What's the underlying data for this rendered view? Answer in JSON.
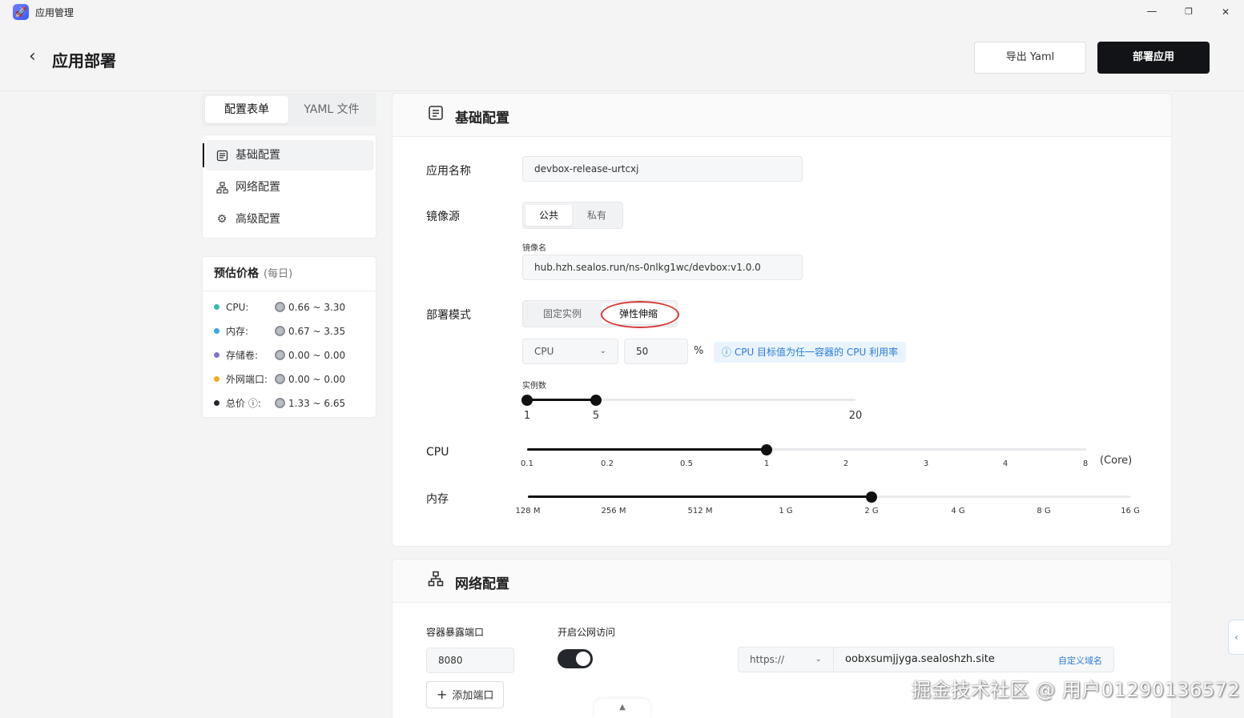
{
  "window": {
    "title": "应用管理",
    "controls": {
      "minimize": "—",
      "maximize": "❐",
      "close": "✕"
    }
  },
  "header": {
    "title": "应用部署",
    "export_label": "导出 Yaml",
    "deploy_label": "部署应用"
  },
  "left_tabs": [
    {
      "label": "配置表单",
      "active": true
    },
    {
      "label": "YAML 文件",
      "active": false
    }
  ],
  "nav": [
    {
      "label": "基础配置",
      "icon": "list-icon",
      "active": true
    },
    {
      "label": "网络配置",
      "icon": "network-icon",
      "active": false
    },
    {
      "label": "高级配置",
      "icon": "gear-icon",
      "active": false
    }
  ],
  "price": {
    "title": "预估价格",
    "subtitle": "(每日)",
    "rows": [
      {
        "label": "CPU:",
        "value": "0.66 ~ 3.30",
        "color": "#33bdb0"
      },
      {
        "label": "内存:",
        "value": "0.67 ~ 3.35",
        "color": "#36a9e9"
      },
      {
        "label": "存储卷:",
        "value": "0.00 ~ 0.00",
        "color": "#8172d8"
      },
      {
        "label": "外网端口:",
        "value": "0.00 ~ 0.00",
        "color": "#f5a623"
      },
      {
        "label": "总价 ⓘ:",
        "value": "1.33 ~ 6.65",
        "color": "#24282c"
      }
    ]
  },
  "basic": {
    "title": "基础配置",
    "app_name_label": "应用名称",
    "app_name_value": "devbox-release-urtcxj",
    "image_source_label": "镜像源",
    "image_source_options": [
      "公共",
      "私有"
    ],
    "image_name_label": "镜像名",
    "image_name_value": "hub.hzh.sealos.run/ns-0nlkg1wc/devbox:v1.0.0",
    "deploy_mode_label": "部署模式",
    "deploy_mode_options": [
      "固定实例",
      "弹性伸缩"
    ],
    "metric_select": "CPU",
    "metric_value": "50",
    "metric_unit": "%",
    "metric_tip": "CPU 目标值为任一容器的 CPU 利用率",
    "instances_label": "实例数",
    "instances": {
      "min": 1,
      "max": 5,
      "scale_min": "1",
      "scale_max": "20"
    },
    "cpu_label": "CPU",
    "cpu_ticks": [
      "0.1",
      "0.2",
      "0.5",
      "1",
      "2",
      "3",
      "4",
      "8"
    ],
    "cpu_selected": "1",
    "cpu_unit": "(Core)",
    "memory_label": "内存",
    "memory_ticks": [
      "128 M",
      "256 M",
      "512 M",
      "1 G",
      "2 G",
      "4 G",
      "8 G",
      "16 G"
    ],
    "memory_selected": "2 G"
  },
  "network": {
    "title": "网络配置",
    "port_label": "容器暴露端口",
    "port_value": "8080",
    "public_access_label": "开启公网访问",
    "public_access_on": true,
    "add_port_label": "添加端口",
    "protocol": "https://",
    "domain": "oobxsumjjyga.sealoshzh.site",
    "custom_domain_label": "自定义域名"
  },
  "watermark": "掘金技术社区 @ 用户01290136572",
  "side_handle_icon": "chevron-left-icon",
  "bottom_handle_icon": "caret-up-icon"
}
